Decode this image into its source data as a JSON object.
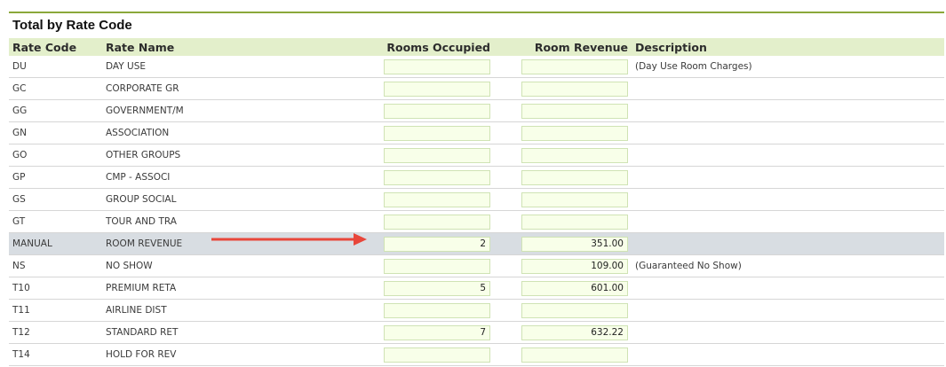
{
  "section": {
    "title": "Total by Rate Code"
  },
  "columns": {
    "rate_code": "Rate Code",
    "rate_name": "Rate Name",
    "rooms_occupied": "Rooms Occupied",
    "room_revenue": "Room Revenue",
    "description": "Description"
  },
  "rows": [
    {
      "code": "DU",
      "name": "DAY USE",
      "rooms": "",
      "revenue": "",
      "description": "(Day Use Room Charges)",
      "highlight": false
    },
    {
      "code": "GC",
      "name": "CORPORATE GR",
      "rooms": "",
      "revenue": "",
      "description": "",
      "highlight": false
    },
    {
      "code": "GG",
      "name": "GOVERNMENT/M",
      "rooms": "",
      "revenue": "",
      "description": "",
      "highlight": false
    },
    {
      "code": "GN",
      "name": "ASSOCIATION",
      "rooms": "",
      "revenue": "",
      "description": "",
      "highlight": false
    },
    {
      "code": "GO",
      "name": "OTHER GROUPS",
      "rooms": "",
      "revenue": "",
      "description": "",
      "highlight": false
    },
    {
      "code": "GP",
      "name": "CMP - ASSOCI",
      "rooms": "",
      "revenue": "",
      "description": "",
      "highlight": false
    },
    {
      "code": "GS",
      "name": "GROUP SOCIAL",
      "rooms": "",
      "revenue": "",
      "description": "",
      "highlight": false
    },
    {
      "code": "GT",
      "name": "TOUR AND TRA",
      "rooms": "",
      "revenue": "",
      "description": "",
      "highlight": false
    },
    {
      "code": "MANUAL",
      "name": "ROOM REVENUE",
      "rooms": "2",
      "revenue": "351.00",
      "description": "",
      "highlight": true
    },
    {
      "code": "NS",
      "name": "NO SHOW",
      "rooms": "",
      "revenue": "109.00",
      "description": "(Guaranteed No Show)",
      "highlight": false
    },
    {
      "code": "T10",
      "name": "PREMIUM RETA",
      "rooms": "5",
      "revenue": "601.00",
      "description": "",
      "highlight": false
    },
    {
      "code": "T11",
      "name": "AIRLINE DIST",
      "rooms": "",
      "revenue": "",
      "description": "",
      "highlight": false
    },
    {
      "code": "T12",
      "name": "STANDARD RET",
      "rooms": "7",
      "revenue": "632.22",
      "description": "",
      "highlight": false
    },
    {
      "code": "T14",
      "name": "HOLD FOR REV",
      "rooms": "",
      "revenue": "",
      "description": "",
      "highlight": false
    }
  ],
  "colors": {
    "accent_border": "#8aa83a",
    "header_bg": "#e3efcb",
    "input_bg": "#f8ffe9",
    "highlight_row": "#d8dde2",
    "arrow": "#e8463a"
  },
  "annotation": {
    "icon": "red-arrow-icon"
  }
}
